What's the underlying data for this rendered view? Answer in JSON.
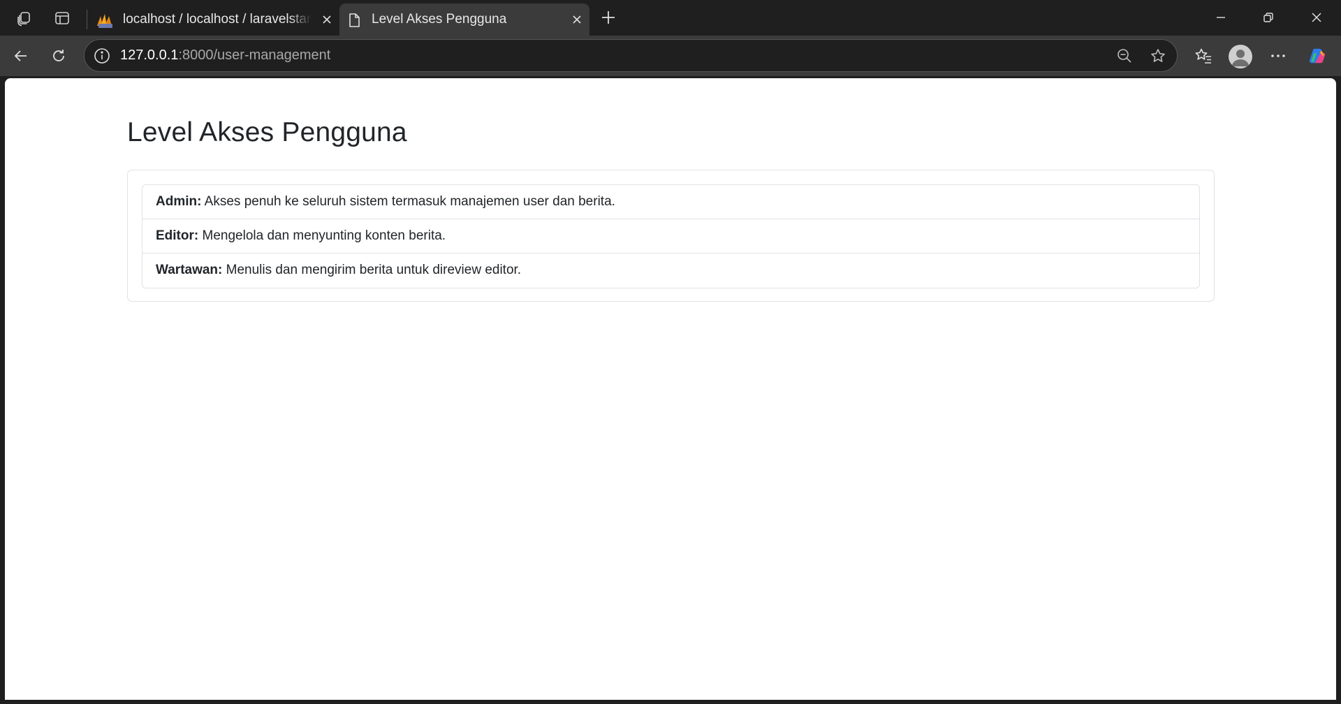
{
  "browser": {
    "tabs": [
      {
        "title": "localhost / localhost / laravelstarter",
        "favicon": "phpmyadmin-favicon",
        "active": false
      },
      {
        "title": "Level Akses Pengguna",
        "favicon": "page-icon",
        "active": true
      }
    ],
    "url": {
      "host": "127.0.0.1",
      "rest": ":8000/user-management"
    },
    "colors": {
      "chrome_dark": "#1f1f1f",
      "chrome_mid": "#3b3b3b",
      "page_bg": "#ffffff"
    }
  },
  "page": {
    "title": "Level Akses Pengguna",
    "roles": [
      {
        "name": "Admin:",
        "description": "Akses penuh ke seluruh sistem termasuk manajemen user dan berita."
      },
      {
        "name": "Editor:",
        "description": "Mengelola dan menyunting konten berita."
      },
      {
        "name": "Wartawan:",
        "description": "Menulis dan mengirim berita untuk direview editor."
      }
    ],
    "colors": {
      "text": "#212529",
      "border": "#dee2e6"
    }
  }
}
